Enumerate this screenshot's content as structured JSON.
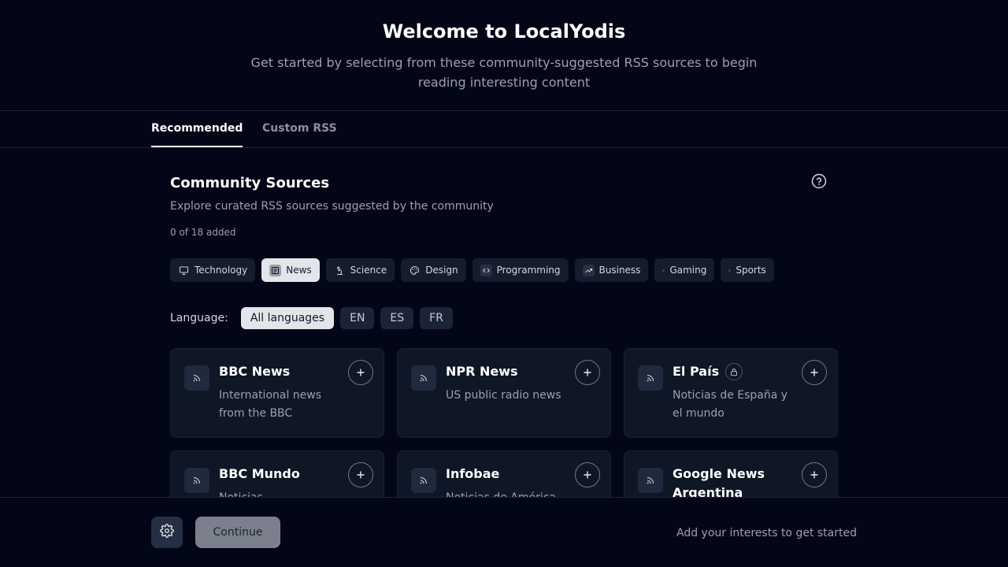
{
  "hero": {
    "title": "Welcome to LocalYodis",
    "subtitle": "Get started by selecting from these community-suggested RSS sources to begin reading interesting content"
  },
  "tabs": [
    {
      "label": "Recommended",
      "active": true
    },
    {
      "label": "Custom RSS",
      "active": false
    }
  ],
  "section": {
    "title": "Community Sources",
    "subtitle": "Explore curated RSS sources suggested by the community",
    "count": "0 of 18 added"
  },
  "categories": [
    {
      "label": "Technology",
      "icon": "monitor-icon",
      "active": false
    },
    {
      "label": "News",
      "icon": "newspaper-icon",
      "active": true
    },
    {
      "label": "Science",
      "icon": "microscope-icon",
      "active": false
    },
    {
      "label": "Design",
      "icon": "palette-icon",
      "active": false
    },
    {
      "label": "Programming",
      "icon": "code-icon",
      "active": false
    },
    {
      "label": "Business",
      "icon": "trending-up-icon",
      "active": false
    },
    {
      "label": "Gaming",
      "icon": "gamepad-icon",
      "active": false
    },
    {
      "label": "Sports",
      "icon": "trophy-icon",
      "active": false
    }
  ],
  "language": {
    "label": "Language:",
    "options": [
      {
        "label": "All languages",
        "active": true
      },
      {
        "label": "EN",
        "active": false
      },
      {
        "label": "ES",
        "active": false
      },
      {
        "label": "FR",
        "active": false
      }
    ]
  },
  "sources": [
    {
      "name": "BBC News",
      "description": "International news from the BBC",
      "locked": false
    },
    {
      "name": "NPR News",
      "description": "US public radio news",
      "locked": false
    },
    {
      "name": "El País",
      "description": "Noticias de España y el mundo",
      "locked": true
    },
    {
      "name": "BBC Mundo",
      "description": "Noticias",
      "locked": false
    },
    {
      "name": "Infobae",
      "description": "Noticias de América",
      "locked": false
    },
    {
      "name": "Google News Argentina",
      "description": "",
      "locked": false
    }
  ],
  "footer": {
    "continue_label": "Continue",
    "hint": "Add your interests to get started"
  },
  "icons": {
    "help": "help-circle-icon",
    "rss": "rss-icon",
    "add": "plus-icon",
    "lock": "lock-icon",
    "settings": "gear-icon"
  }
}
